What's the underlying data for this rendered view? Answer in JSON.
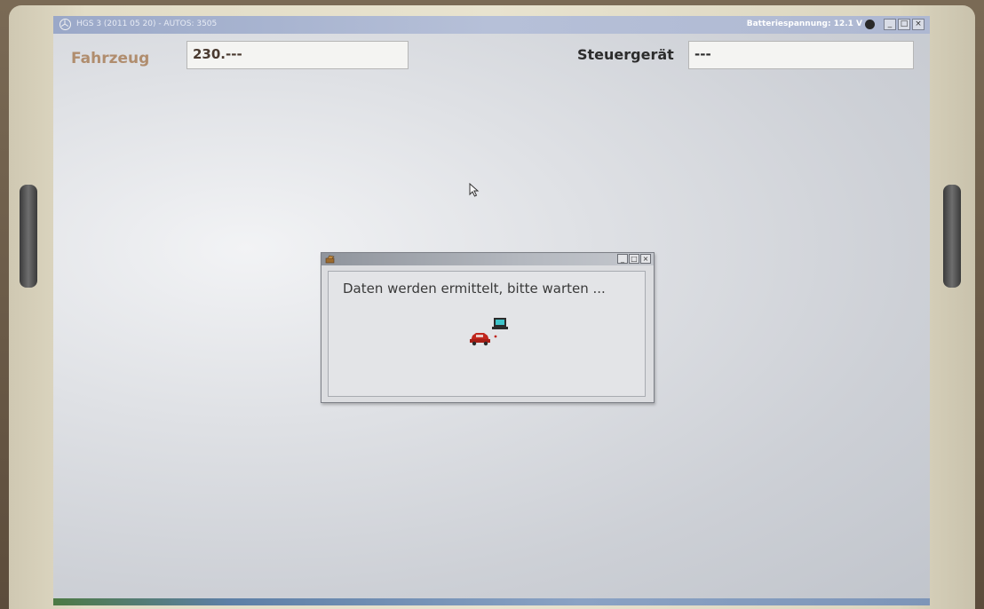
{
  "window": {
    "title": "HGS 3 (2011 05 20) - AUTOS: 3505",
    "battery_label": "Batteriespannung: 12.1 V",
    "controls": {
      "minimize": "_",
      "maximize": "□",
      "close": "×"
    }
  },
  "header": {
    "vehicle_label": "Fahrzeug",
    "vehicle_value": "230.---",
    "ecu_label": "Steuergerät",
    "ecu_value": "---"
  },
  "dialog": {
    "message": "Daten werden ermittelt, bitte warten ...",
    "controls": {
      "minimize": "_",
      "maximize": "□",
      "close": "×"
    }
  },
  "icons": {
    "app_logo": "mercedes-star-icon",
    "battery": "battery-status-icon",
    "cursor": "mouse-pointer-icon",
    "dialog_app": "toolbox-icon",
    "progress": "car-to-laptop-connection-icon"
  },
  "colors": {
    "vehicle_label": "#b08d6e",
    "titlebar": "#9aa8c8",
    "background": "#dfe1e5"
  }
}
